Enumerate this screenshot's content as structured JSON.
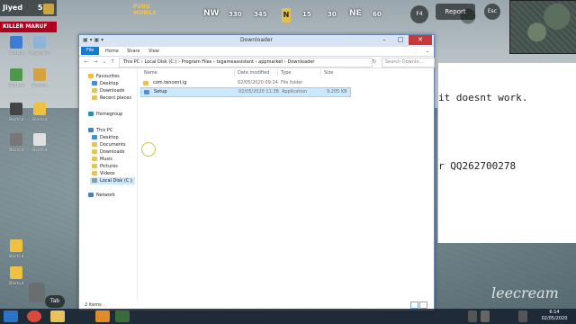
{
  "hud": {
    "player_name": "Jiyed",
    "player_level": "5",
    "killer_tag": "KILLER MARUF",
    "game_logo": "PUBG MOBILE",
    "compass": [
      "NW",
      "330",
      "345",
      "N",
      "15",
      "30",
      "NE",
      "60"
    ],
    "report": "Report",
    "esc": "Esc",
    "f4": "F4",
    "tab": "Tab"
  },
  "desktop_icons": [
    {
      "label": "Shortcut",
      "color": "#3d7bd6"
    },
    {
      "label": "Recycle Bin",
      "color": "#8fb3d9"
    },
    {
      "label": "Shortcut",
      "color": "#4a9a4a"
    },
    {
      "label": "Shortcut",
      "color": "#d6a23d"
    },
    {
      "label": "Shortcut",
      "color": "#444444"
    },
    {
      "label": "Shortcut",
      "color": "#f0c040"
    },
    {
      "label": "Shortcut",
      "color": "#777777"
    },
    {
      "label": "Shortcut",
      "color": "#e0e0e0"
    },
    {
      "label": "Shortcut",
      "color": "#f0c040"
    },
    {
      "label": "Shortcut",
      "color": "#f0c040"
    }
  ],
  "notepad": {
    "line1": "it doesnt work.",
    "line2": "r QQ262700278"
  },
  "explorer": {
    "title": "Downloader",
    "ribbon_tabs": [
      "File",
      "Home",
      "Share",
      "View"
    ],
    "address": "This PC  ›  Local Disk (C:)  ›  Program Files  ›  txgameassistant  ›  appmarket  ›  Downloader",
    "search_placeholder": "Search Downlo...",
    "nav": {
      "favourites": "Favourites",
      "fav_items": [
        "Desktop",
        "Downloads",
        "Recent places"
      ],
      "homegroup": "Homegroup",
      "this_pc": "This PC",
      "pc_items": [
        "Desktop",
        "Documents",
        "Downloads",
        "Music",
        "Pictures",
        "Videos",
        "Local Disk (C:)"
      ],
      "network": "Network"
    },
    "columns": {
      "name": "Name",
      "date": "Date modified",
      "type": "Type",
      "size": "Size"
    },
    "files": [
      {
        "name": "com.tencent.ig",
        "date": "02/05/2020 09:24",
        "type": "File folder",
        "size": ""
      },
      {
        "name": "Setup",
        "date": "02/05/2020 11:38",
        "type": "Application",
        "size": "9,205 KB"
      }
    ],
    "status": "2 items"
  },
  "taskbar": {
    "clock_time": "6:14",
    "clock_date": "02/05/2020"
  },
  "watermark": "leecream",
  "colors": {
    "accent": "#1979ca",
    "selection": "#cce8ff",
    "folder": "#e8c15a",
    "close": "#c7383a"
  }
}
